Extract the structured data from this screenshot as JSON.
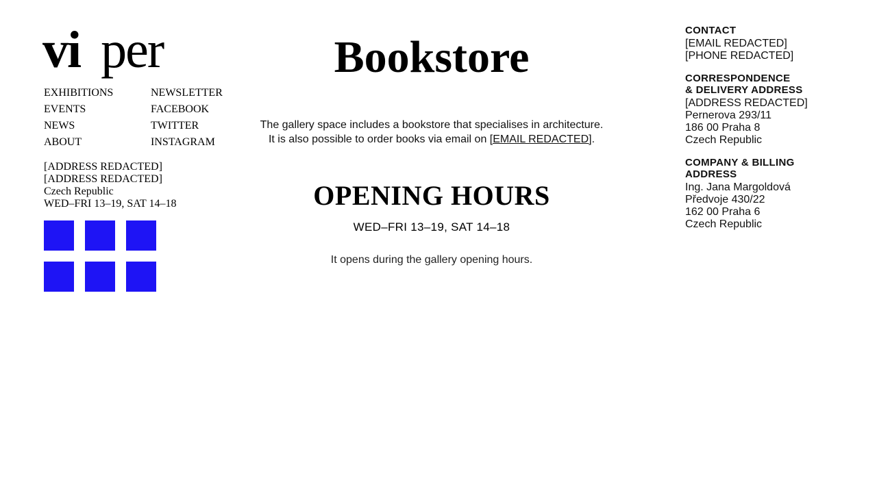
{
  "brand": {
    "logo_part_1": "vi",
    "logo_part_2": "per"
  },
  "nav": {
    "left": [
      "EXHIBITIONS",
      "EVENTS",
      "NEWS",
      "ABOUT"
    ],
    "right": [
      "NEWSLETTER",
      "FACEBOOK",
      "TWITTER",
      "INSTAGRAM"
    ]
  },
  "left_info": {
    "address_line_1": "[ADDRESS REDACTED]",
    "address_line_2": "[ADDRESS REDACTED]",
    "country": "Czech Republic",
    "hours": "WED–FRI 13–19, SAT 14–18"
  },
  "colors": {
    "square_blue": "#1e14f5"
  },
  "main": {
    "title": "Bookstore",
    "intro_line_1": "The gallery space includes a bookstore that specialises in architecture.",
    "intro_line_2_before": "It is also possible to order books via email on ",
    "intro_email": "[EMAIL REDACTED]",
    "intro_line_2_after": ".",
    "hours_title": "OPENING HOURS",
    "hours_line": "WED–FRI 13–19, SAT 14–18",
    "hours_note": "It opens during the gallery opening hours."
  },
  "contact": {
    "heading": "CONTACT",
    "email": "[EMAIL REDACTED]",
    "phone": "[PHONE REDACTED]"
  },
  "correspondence": {
    "heading_1": "CORRESPONDENCE",
    "heading_2": "& DELIVERY ADDRESS",
    "lines": [
      "[ADDRESS REDACTED]",
      "Pernerova 293/11",
      "186 00 Praha 8",
      "Czech Republic"
    ]
  },
  "billing": {
    "heading_1": "COMPANY & BILLING",
    "heading_2": "ADDRESS",
    "lines": [
      "Ing. Jana Margoldová",
      "Předvoje 430/22",
      "162 00 Praha 6",
      "Czech Republic"
    ]
  }
}
